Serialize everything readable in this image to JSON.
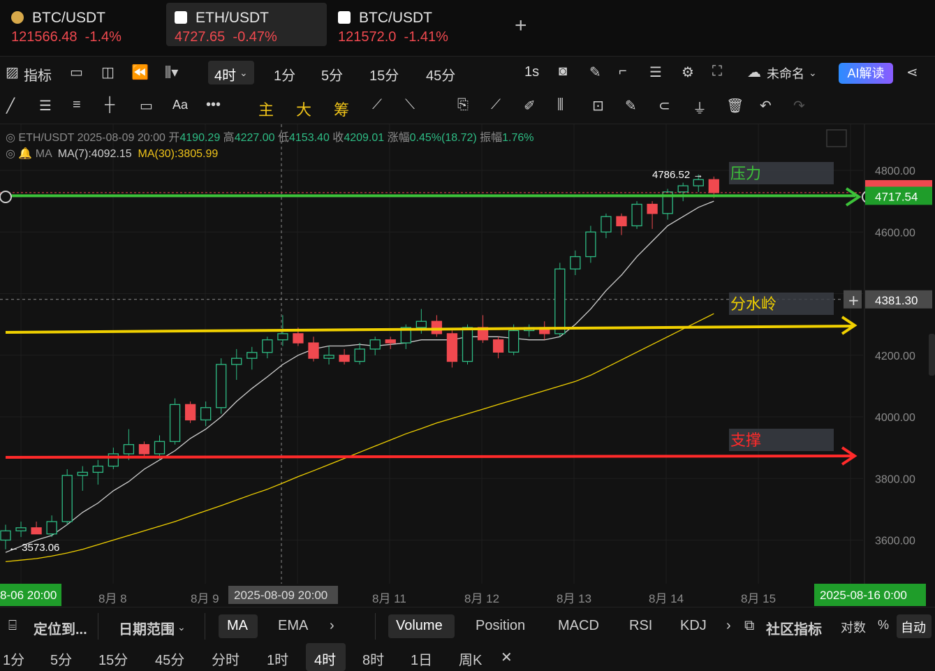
{
  "tabs": [
    {
      "symbol": "BTC/USDT",
      "price": "121566.48",
      "change": "-1.4%",
      "icon": "coin-icon"
    },
    {
      "symbol": "ETH/USDT",
      "price": "4727.65",
      "change": "-0.47%",
      "icon": "exchange-icon"
    },
    {
      "symbol": "BTC/USDT",
      "price": "121572.0",
      "change": "-1.41%",
      "icon": "exchange-icon"
    }
  ],
  "toolbar": {
    "indicators": "指标",
    "interval_selected": "4时",
    "intervals": [
      "1分",
      "5分",
      "15分",
      "45分"
    ],
    "one_s": "1s",
    "layout_name": "未命名",
    "ai_label": "AI解读"
  },
  "drawbar": {
    "main": "主",
    "big": "大",
    "chip": "筹",
    "text_tool": "Aa"
  },
  "ohlc": {
    "symbol": "ETH/USDT",
    "time": "2025-08-09 20:00",
    "open_label": "开",
    "open": "4190.29",
    "high_label": "高",
    "high": "4227.00",
    "low_label": "低",
    "low": "4153.40",
    "close_label": "收",
    "close": "4209.01",
    "chg_label": "涨幅",
    "chg": "0.45%(18.72)",
    "amp_label": "振幅",
    "amp": "1.76%"
  },
  "ma": {
    "label": "MA",
    "ma7": "MA(7):4092.15",
    "ma30": "MA(30):3805.99"
  },
  "annotations": {
    "resistance": "压力",
    "watershed": "分水岭",
    "support": "支撑"
  },
  "price_axis": {
    "labels": [
      "4800.00",
      "4600.00",
      "4200.00",
      "4000.00",
      "3800.00",
      "3600.00"
    ],
    "current": "4717.54",
    "crosshair": "4381.30",
    "max_label": "4786.52",
    "min_label": "3573.06"
  },
  "time_axis": {
    "start": "8-06 20:00",
    "labels": [
      "8月 8",
      "8月 9",
      "8月 11",
      "8月 12",
      "8月 13",
      "8月 14",
      "8月 15"
    ],
    "crosshair": "2025-08-09 20:00",
    "end": "2025-08-16 0:00"
  },
  "indicator_bar": {
    "locate": "定位到...",
    "date_range": "日期范围",
    "main_inds": [
      "MA",
      "EMA"
    ],
    "sub_inds": [
      "Volume",
      "Position",
      "MACD",
      "RSI",
      "KDJ"
    ],
    "community": "社区指标",
    "log": "对数",
    "pct": "%",
    "auto": "自动"
  },
  "periods": [
    "1分",
    "5分",
    "15分",
    "45分",
    "分时",
    "1时",
    "4时",
    "8时",
    "1日",
    "周K"
  ],
  "period_selected": "4时",
  "colors": {
    "up": "#2ebd85",
    "down": "#f0494f",
    "ma7": "#cfcfcf",
    "ma30": "#f0d000"
  },
  "chart_data": {
    "type": "candlestick",
    "series": [
      {
        "name": "ETH/USDT",
        "candles": [
          [
            3600,
            3650,
            3570,
            3630
          ],
          [
            3630,
            3660,
            3610,
            3640
          ],
          [
            3640,
            3660,
            3620,
            3620
          ],
          [
            3620,
            3680,
            3610,
            3660
          ],
          [
            3660,
            3830,
            3650,
            3810
          ],
          [
            3810,
            3840,
            3760,
            3820
          ],
          [
            3820,
            3860,
            3780,
            3840
          ],
          [
            3840,
            3900,
            3830,
            3880
          ],
          [
            3880,
            3960,
            3860,
            3910
          ],
          [
            3910,
            3920,
            3870,
            3880
          ],
          [
            3880,
            3940,
            3860,
            3920
          ],
          [
            3920,
            4060,
            3910,
            4040
          ],
          [
            4040,
            4050,
            3980,
            3990
          ],
          [
            3990,
            4050,
            3970,
            4030
          ],
          [
            4030,
            4190,
            4010,
            4170
          ],
          [
            4170,
            4220,
            4120,
            4190
          ],
          [
            4190,
            4227,
            4153.4,
            4209.01
          ],
          [
            4209.01,
            4260,
            4190,
            4250
          ],
          [
            4250,
            4330,
            4230,
            4270
          ],
          [
            4270,
            4290,
            4230,
            4240
          ],
          [
            4240,
            4260,
            4180,
            4190
          ],
          [
            4190,
            4230,
            4170,
            4200
          ],
          [
            4200,
            4220,
            4170,
            4180
          ],
          [
            4180,
            4240,
            4170,
            4220
          ],
          [
            4220,
            4260,
            4200,
            4250
          ],
          [
            4250,
            4260,
            4220,
            4240
          ],
          [
            4240,
            4300,
            4220,
            4290
          ],
          [
            4290,
            4350,
            4270,
            4310
          ],
          [
            4310,
            4330,
            4260,
            4270
          ],
          [
            4270,
            4280,
            4160,
            4180
          ],
          [
            4180,
            4300,
            4170,
            4290
          ],
          [
            4290,
            4330,
            4240,
            4250
          ],
          [
            4250,
            4260,
            4190,
            4210
          ],
          [
            4210,
            4300,
            4200,
            4280
          ],
          [
            4280,
            4300,
            4260,
            4290
          ],
          [
            4290,
            4310,
            4250,
            4270
          ],
          [
            4270,
            4500,
            4260,
            4480
          ],
          [
            4480,
            4540,
            4460,
            4520
          ],
          [
            4520,
            4620,
            4500,
            4600
          ],
          [
            4600,
            4660,
            4580,
            4650
          ],
          [
            4650,
            4660,
            4590,
            4620
          ],
          [
            4620,
            4700,
            4610,
            4690
          ],
          [
            4690,
            4700,
            4610,
            4660
          ],
          [
            4660,
            4740,
            4640,
            4730
          ],
          [
            4730,
            4760,
            4700,
            4750
          ],
          [
            4750,
            4786.52,
            4730,
            4770
          ],
          [
            4770,
            4780,
            4710,
            4727.65
          ]
        ]
      },
      {
        "name": "MA(7)",
        "values": [
          3560,
          3580,
          3600,
          3615,
          3650,
          3690,
          3720,
          3760,
          3790,
          3830,
          3860,
          3890,
          3930,
          3960,
          4000,
          4050,
          4092.15,
          4130,
          4170,
          4200,
          4220,
          4230,
          4230,
          4235,
          4230,
          4235,
          4240,
          4250,
          4250,
          4250,
          4260,
          4260,
          4260,
          4255,
          4250,
          4250,
          4260,
          4300,
          4350,
          4410,
          4460,
          4520,
          4570,
          4620,
          4650,
          4680,
          4700
        ]
      },
      {
        "name": "MA(30)",
        "values": [
          3530,
          3535,
          3540,
          3548,
          3558,
          3570,
          3585,
          3600,
          3615,
          3630,
          3645,
          3660,
          3678,
          3695,
          3712,
          3730,
          3748,
          3765,
          3785,
          3805.99,
          3825,
          3845,
          3865,
          3885,
          3905,
          3925,
          3945,
          3962,
          3980,
          3995,
          4010,
          4025,
          4040,
          4055,
          4070,
          4085,
          4100,
          4115,
          4135,
          4160,
          4185,
          4210,
          4235,
          4260,
          4285,
          4310,
          4335
        ]
      }
    ],
    "ylim": [
      3500,
      4860
    ],
    "horizontal_levels": [
      {
        "value": 4717.54,
        "color": "#3dc23a"
      },
      {
        "value": 4290,
        "color": "#f0d000"
      },
      {
        "value": 3870,
        "color": "#ff2a2a"
      }
    ]
  }
}
